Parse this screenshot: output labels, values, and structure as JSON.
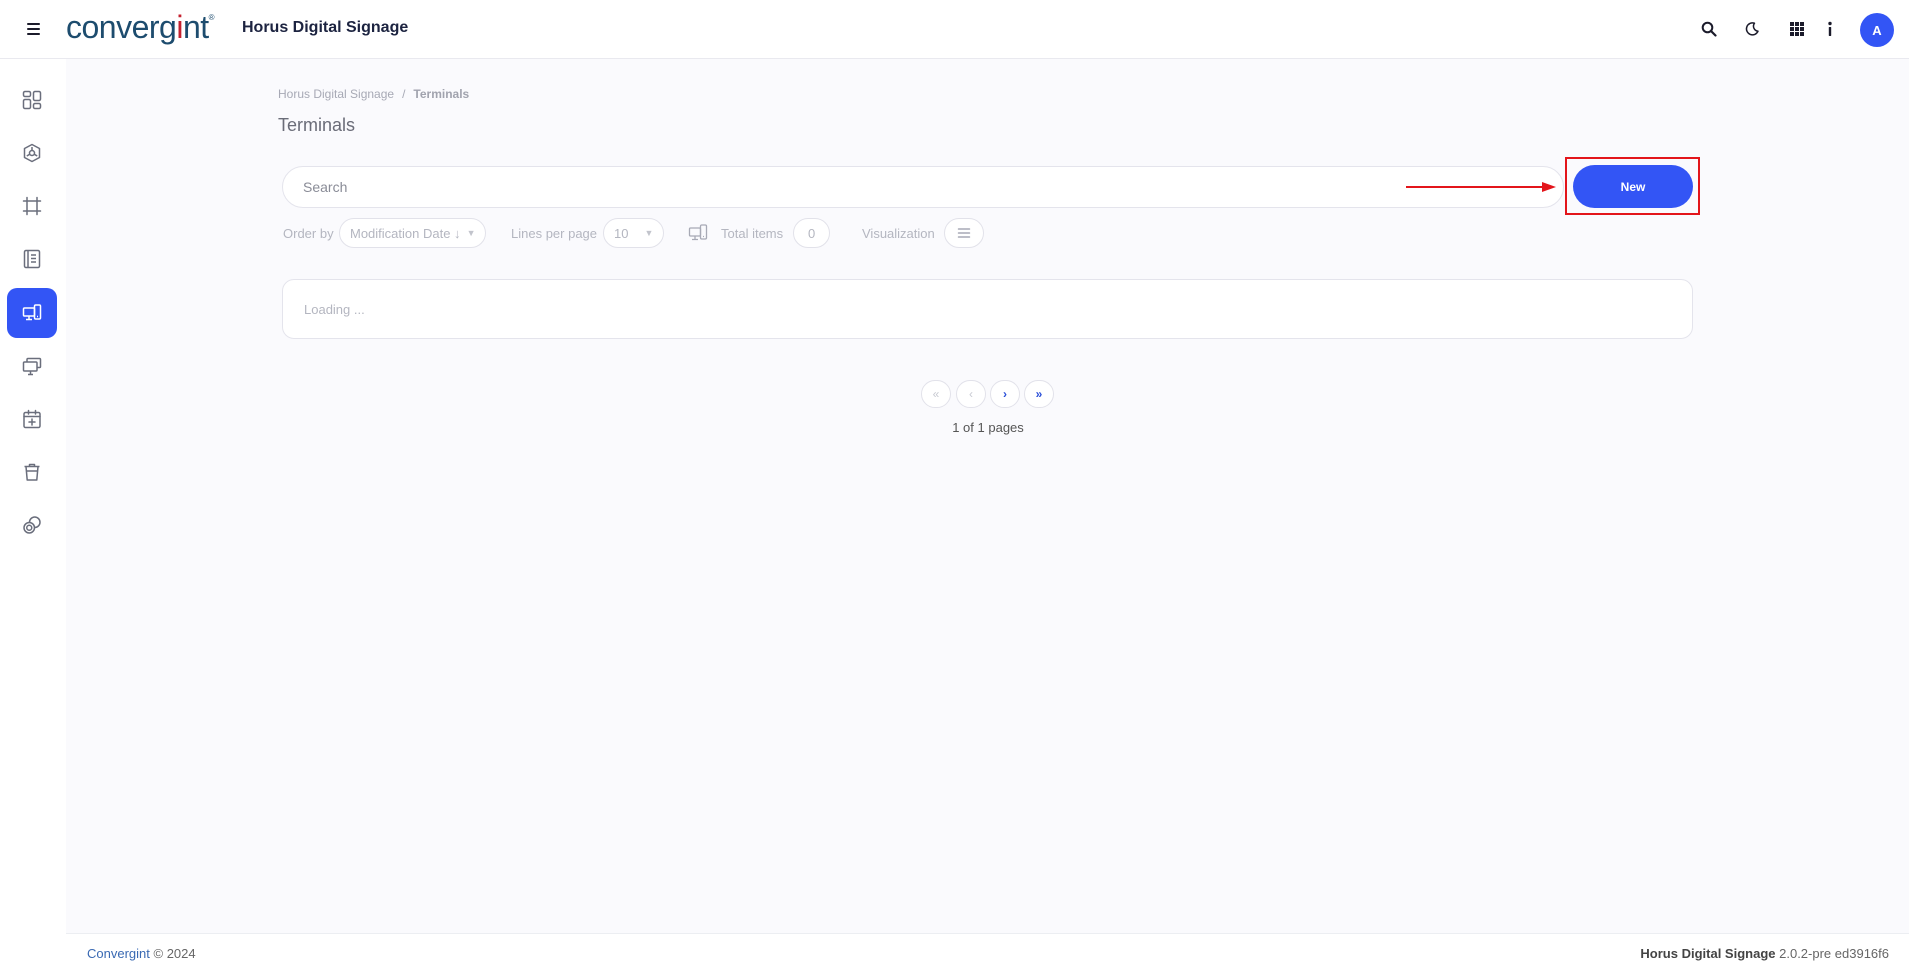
{
  "header": {
    "logo_pre": "converg",
    "logo_accent": "i",
    "logo_post": "nt",
    "logo_mark": "®",
    "app_title": "Horus Digital Signage",
    "avatar_initial": "A",
    "icons": [
      "search-icon",
      "moon-icon",
      "apps-grid-icon",
      "info-icon"
    ]
  },
  "sidebar": {
    "items": [
      {
        "icon": "dashboard-icon",
        "active": false
      },
      {
        "icon": "hexagon-icon",
        "active": false
      },
      {
        "icon": "frame-icon",
        "active": false
      },
      {
        "icon": "playlist-icon",
        "active": false
      },
      {
        "icon": "terminal-devices-icon",
        "active": true
      },
      {
        "icon": "screens-icon",
        "active": false
      },
      {
        "icon": "calendar-add-icon",
        "active": false
      },
      {
        "icon": "trash-icon",
        "active": false
      },
      {
        "icon": "copy-icon",
        "active": false
      }
    ]
  },
  "breadcrumb": {
    "root": "Horus Digital Signage",
    "separator": "/",
    "current": "Terminals"
  },
  "page": {
    "title": "Terminals"
  },
  "search": {
    "placeholder": "Search",
    "value": ""
  },
  "actions": {
    "new_label": "New"
  },
  "toolbar": {
    "order_by_label": "Order by",
    "order_by_value": "Modification Date ↓",
    "lines_label": "Lines per page",
    "lines_value": "10",
    "total_label": "Total items",
    "total_value": "0",
    "visualization_label": "Visualization"
  },
  "list": {
    "status": "Loading ..."
  },
  "pagination": {
    "first": "«",
    "prev": "‹",
    "next": "›",
    "last": "»",
    "label": "1 of 1 pages"
  },
  "footer": {
    "brand": "Convergint",
    "copyright": "© 2024",
    "product": "Horus Digital Signage",
    "version": "2.0.2-pre ed3916f6"
  },
  "colors": {
    "primary": "#3355f5",
    "highlight": "#e3151b",
    "logo": "#1d4c6e",
    "logo_accent": "#c4212f"
  }
}
